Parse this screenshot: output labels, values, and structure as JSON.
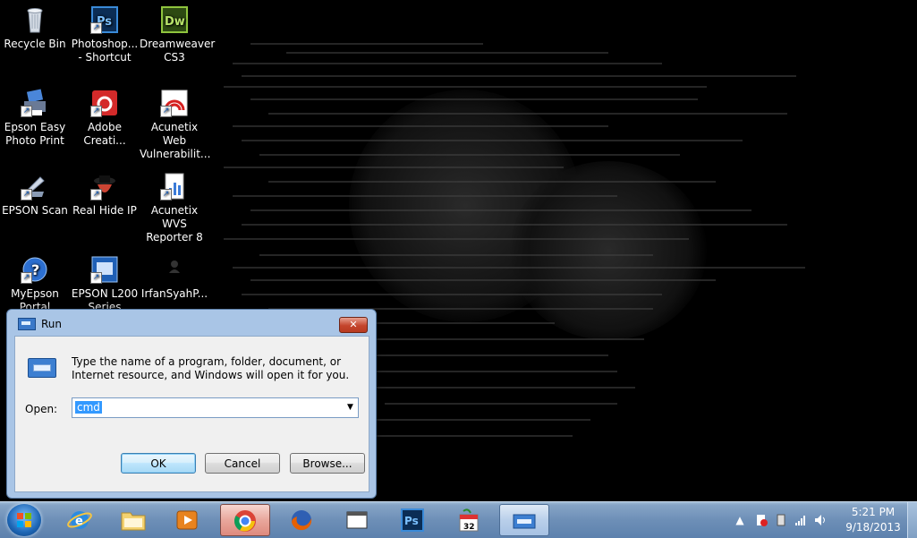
{
  "desktop": {
    "icons": [
      {
        "label": "Recycle Bin",
        "icon": "recycle-bin-icon"
      },
      {
        "label": "Photoshop... - Shortcut",
        "icon": "photoshop-icon"
      },
      {
        "label": "Dreamweaver CS3",
        "icon": "dreamweaver-icon",
        "badge": "Dw"
      },
      {
        "label": "Epson Easy Photo Print",
        "icon": "epson-photo-print-icon"
      },
      {
        "label": "Adobe Creati...",
        "icon": "adobe-creative-cloud-icon"
      },
      {
        "label": "Acunetix Web Vulnerabilit...",
        "icon": "acunetix-web-icon"
      },
      {
        "label": "EPSON Scan",
        "icon": "epson-scan-icon"
      },
      {
        "label": "Real Hide IP",
        "icon": "real-hide-ip-icon"
      },
      {
        "label": "Acunetix WVS Reporter 8",
        "icon": "acunetix-reporter-icon"
      },
      {
        "label": "MyEpson Portal",
        "icon": "myepson-portal-icon"
      },
      {
        "label": "EPSON L200 Series Manual",
        "icon": "epson-manual-icon"
      },
      {
        "label": "IrfanSyahP...",
        "icon": "user-folder-icon"
      }
    ]
  },
  "run_dialog": {
    "title": "Run",
    "close_glyph": "✕",
    "description": "Type the name of a program, folder, document, or Internet resource, and Windows will open it for you.",
    "open_label": "Open:",
    "open_value": "cmd",
    "ok_label": "OK",
    "cancel_label": "Cancel",
    "browse_label": "Browse..."
  },
  "taskbar": {
    "pinned": [
      {
        "name": "internet-explorer",
        "icon": "internet-explorer-icon"
      },
      {
        "name": "windows-explorer",
        "icon": "folder-icon"
      },
      {
        "name": "media-player",
        "icon": "media-player-icon"
      },
      {
        "name": "chrome",
        "icon": "chrome-icon",
        "active": true
      },
      {
        "name": "firefox",
        "icon": "firefox-icon"
      },
      {
        "name": "window-app",
        "icon": "window-icon"
      },
      {
        "name": "photoshop",
        "icon": "photoshop-icon",
        "badge": "Ps"
      },
      {
        "name": "calendar-app",
        "icon": "calendar-icon",
        "badge": "32"
      },
      {
        "name": "run",
        "icon": "run-icon",
        "active": true
      }
    ],
    "clock_time": "5:21 PM",
    "clock_date": "9/18/2013"
  },
  "colors": {
    "desktop_bg": "#000000",
    "dialog_frame": "#a9c5e6",
    "selection": "#3399ff",
    "taskbar": "#6d8fb7"
  }
}
